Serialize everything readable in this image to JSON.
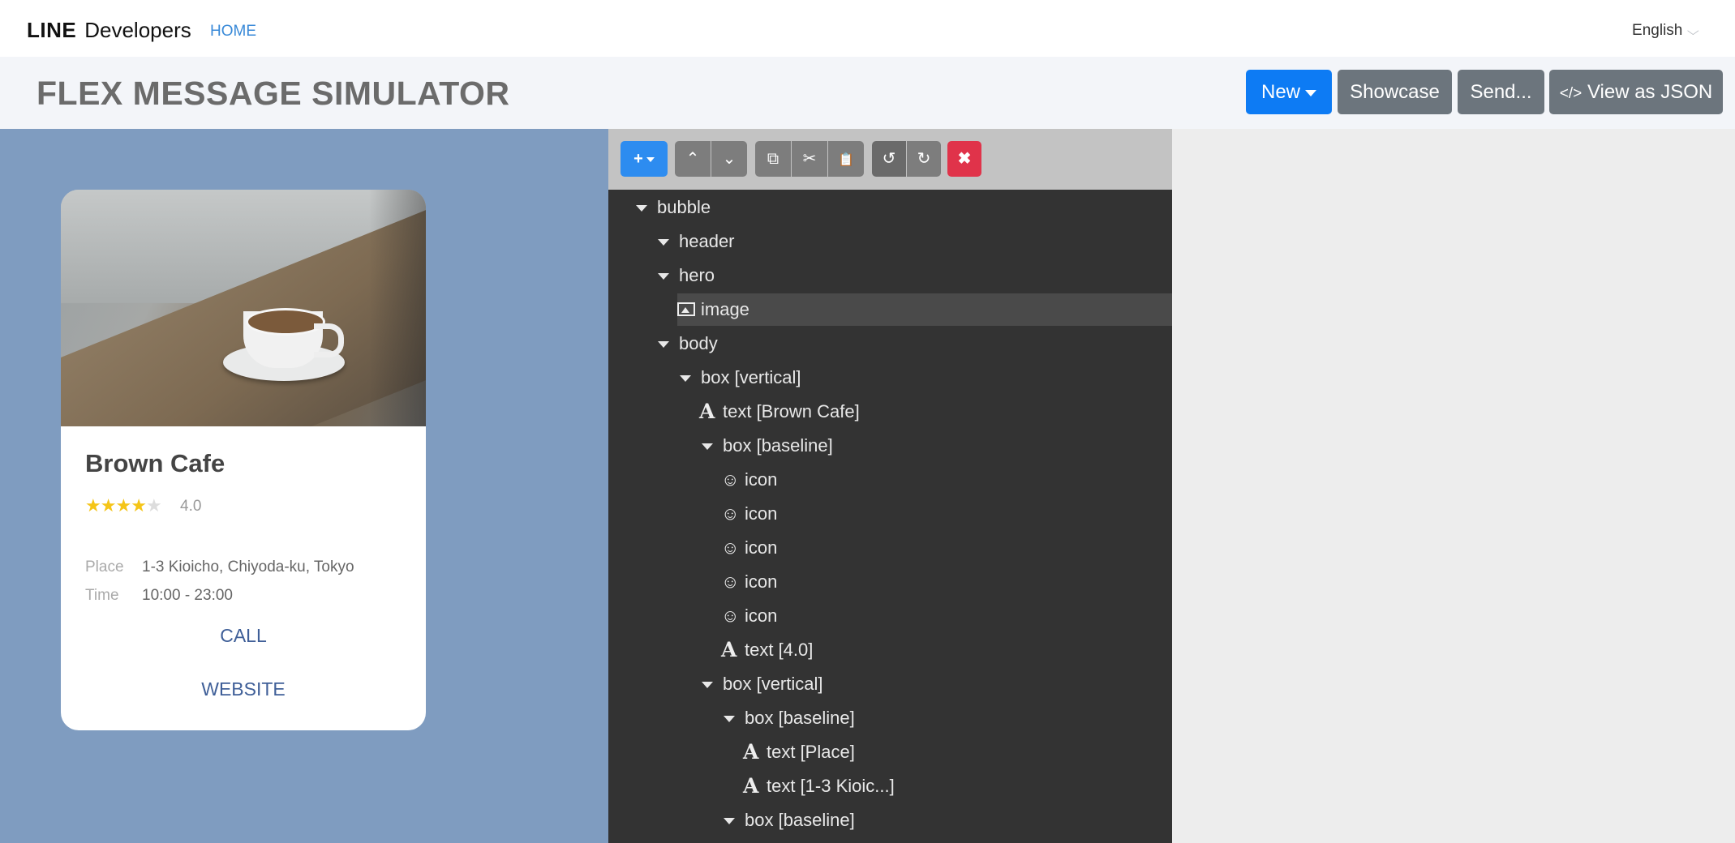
{
  "nav": {
    "logo_bold": "LINE",
    "logo_text": "Developers",
    "home": "HOME",
    "language": "English"
  },
  "header": {
    "title": "FLEX MESSAGE SIMULATOR",
    "buttons": {
      "new": "New",
      "showcase": "Showcase",
      "send": "Send...",
      "json_icon": "</>",
      "json": "View as JSON"
    }
  },
  "card": {
    "title": "Brown Cafe",
    "stars": {
      "filled": 4,
      "total": 5
    },
    "rating": "4.0",
    "place_label": "Place",
    "place_value": "1-3 Kioicho, Chiyoda-ku, Tokyo",
    "time_label": "Time",
    "time_value": "10:00 - 23:00",
    "call": "CALL",
    "website": "WEBSITE"
  },
  "toolbar": {
    "add": "+",
    "up": "⌃",
    "down": "⌄",
    "copy": "⧉",
    "cut": "✂",
    "paste": "📋",
    "undo": "↺",
    "redo": "↻",
    "delete": "✖"
  },
  "tree": [
    {
      "label": "bubble",
      "level": 0,
      "icon": "expand"
    },
    {
      "label": "header",
      "level": 1,
      "icon": "expand"
    },
    {
      "label": "hero",
      "level": 1,
      "icon": "expand"
    },
    {
      "label": "image",
      "level": 2,
      "icon": "image",
      "selected": true
    },
    {
      "label": "body",
      "level": 1,
      "icon": "expand"
    },
    {
      "label": "box [vertical]",
      "level": 2,
      "icon": "expand"
    },
    {
      "label": "text [Brown Cafe]",
      "level": 3,
      "icon": "text"
    },
    {
      "label": "box [baseline]",
      "level": 3,
      "icon": "expand"
    },
    {
      "label": "icon",
      "level": 4,
      "icon": "smiley"
    },
    {
      "label": "icon",
      "level": 4,
      "icon": "smiley"
    },
    {
      "label": "icon",
      "level": 4,
      "icon": "smiley"
    },
    {
      "label": "icon",
      "level": 4,
      "icon": "smiley"
    },
    {
      "label": "icon",
      "level": 4,
      "icon": "smiley"
    },
    {
      "label": "text [4.0]",
      "level": 4,
      "icon": "text"
    },
    {
      "label": "box [vertical]",
      "level": 3,
      "icon": "expand"
    },
    {
      "label": "box [baseline]",
      "level": 4,
      "icon": "expand"
    },
    {
      "label": "text [Place]",
      "level": 5,
      "icon": "text"
    },
    {
      "label": "text [1-3 Kioic...]",
      "level": 5,
      "icon": "text"
    },
    {
      "label": "box [baseline]",
      "level": 4,
      "icon": "expand"
    }
  ]
}
